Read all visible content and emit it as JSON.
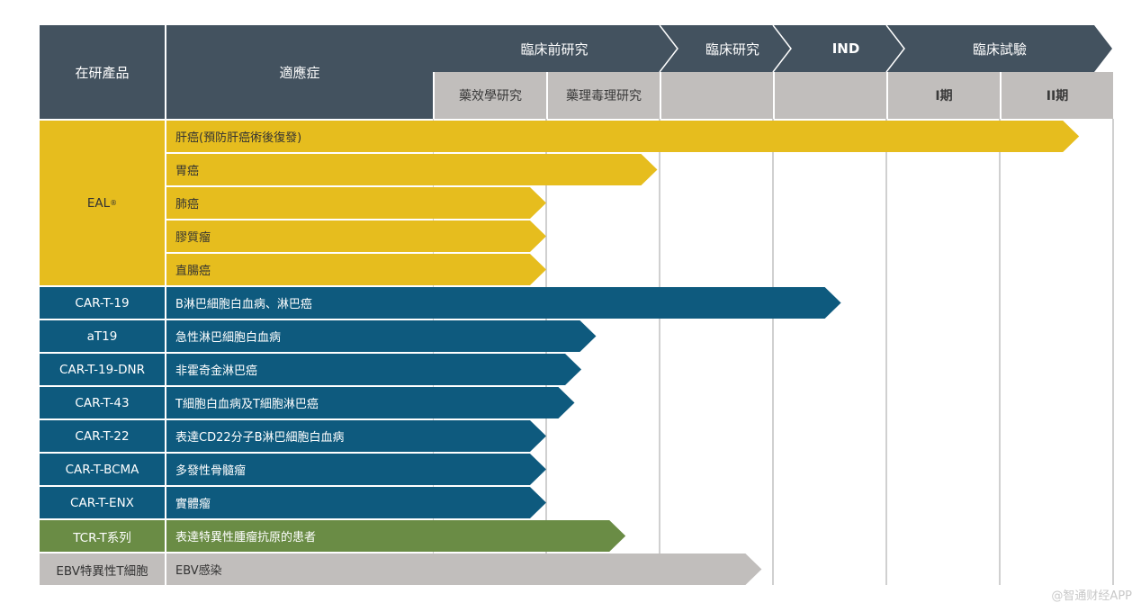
{
  "header": {
    "product": "在研產品",
    "indication": "適應症",
    "stages": [
      "臨床前研究",
      "臨床研究",
      "IND",
      "臨床試驗"
    ],
    "subcolumns": [
      "藥效學研究",
      "藥理毒理研究",
      "",
      "",
      "I期",
      "II期"
    ]
  },
  "colors": {
    "header": "#43525f",
    "gold": "#e6bd1e",
    "blue": "#0e5a7e",
    "green": "#6a8c45",
    "gray": "#c1bebc"
  },
  "groups": [
    {
      "product": "EAL",
      "sup": "®",
      "color": "#e6bd1e",
      "text": "#333",
      "rows": [
        {
          "indication": "肝癌(預防肝癌術後復發)",
          "progress": 5.7
        },
        {
          "indication": "胃癌",
          "progress": 1.98
        },
        {
          "indication": "肺癌",
          "progress": 1.0
        },
        {
          "indication": "膠質瘤",
          "progress": 1.0
        },
        {
          "indication": "直腸癌",
          "progress": 1.0
        }
      ]
    },
    {
      "product": "CAR-T-19",
      "color": "#0e5a7e",
      "text": "#fff",
      "rows": [
        {
          "indication": "B淋巴細胞白血病、淋巴癌",
          "progress": 3.6
        }
      ]
    },
    {
      "product": "aT19",
      "color": "#0e5a7e",
      "text": "#fff",
      "rows": [
        {
          "indication": "急性淋巴細胞白血病",
          "progress": 1.44
        }
      ]
    },
    {
      "product": "CAR-T-19-DNR",
      "color": "#0e5a7e",
      "text": "#fff",
      "rows": [
        {
          "indication": "非霍奇金淋巴癌",
          "progress": 1.31
        }
      ]
    },
    {
      "product": "CAR-T-43",
      "color": "#0e5a7e",
      "text": "#fff",
      "rows": [
        {
          "indication": "T細胞白血病及T細胞淋巴癌",
          "progress": 1.25
        }
      ]
    },
    {
      "product": "CAR-T-22",
      "color": "#0e5a7e",
      "text": "#fff",
      "rows": [
        {
          "indication": "表達CD22分子B淋巴細胞白血病",
          "progress": 1.0
        }
      ]
    },
    {
      "product": "CAR-T-BCMA",
      "color": "#0e5a7e",
      "text": "#fff",
      "rows": [
        {
          "indication": "多發性骨髓瘤",
          "progress": 1.0
        }
      ]
    },
    {
      "product": "CAR-T-ENX",
      "color": "#0e5a7e",
      "text": "#fff",
      "rows": [
        {
          "indication": "實體瘤",
          "progress": 1.0
        }
      ]
    },
    {
      "product": "TCR-T系列",
      "color": "#6a8c45",
      "text": "#fff",
      "rows": [
        {
          "indication": "表達特異性腫瘤抗原的患者",
          "progress": 1.7
        }
      ]
    },
    {
      "product": "EBV特異性T細胞",
      "color": "#c1bebc",
      "text": "#333",
      "rows": [
        {
          "indication": "EBV感染",
          "progress": 2.9
        }
      ]
    }
  ],
  "watermark": "@智通财经APP"
}
